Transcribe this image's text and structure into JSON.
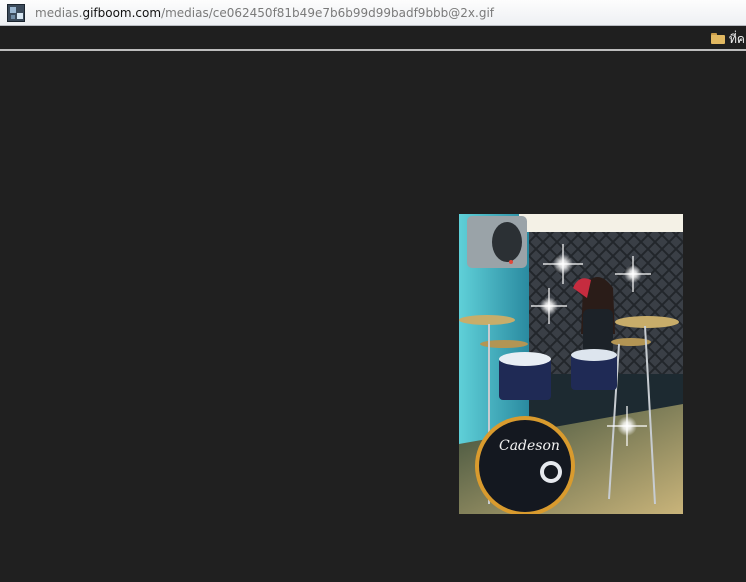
{
  "address_bar": {
    "url_prefix": "medias.",
    "url_host": "gifboom.com",
    "url_path": "/medias/ce062450f81b49e7b6b99d99badf9bbb@2x.gif",
    "favicon": "gif-thumbnail-icon"
  },
  "bookmarks_bar": {
    "folder_label": "ที่ค",
    "folder_icon": "folder-icon"
  },
  "image": {
    "drum_brand": "Cadeson",
    "alt": ""
  },
  "colors": {
    "page_background": "#202020",
    "address_bar": "#f3f4f6",
    "bookmarks_bar": "#1f1f1f"
  }
}
